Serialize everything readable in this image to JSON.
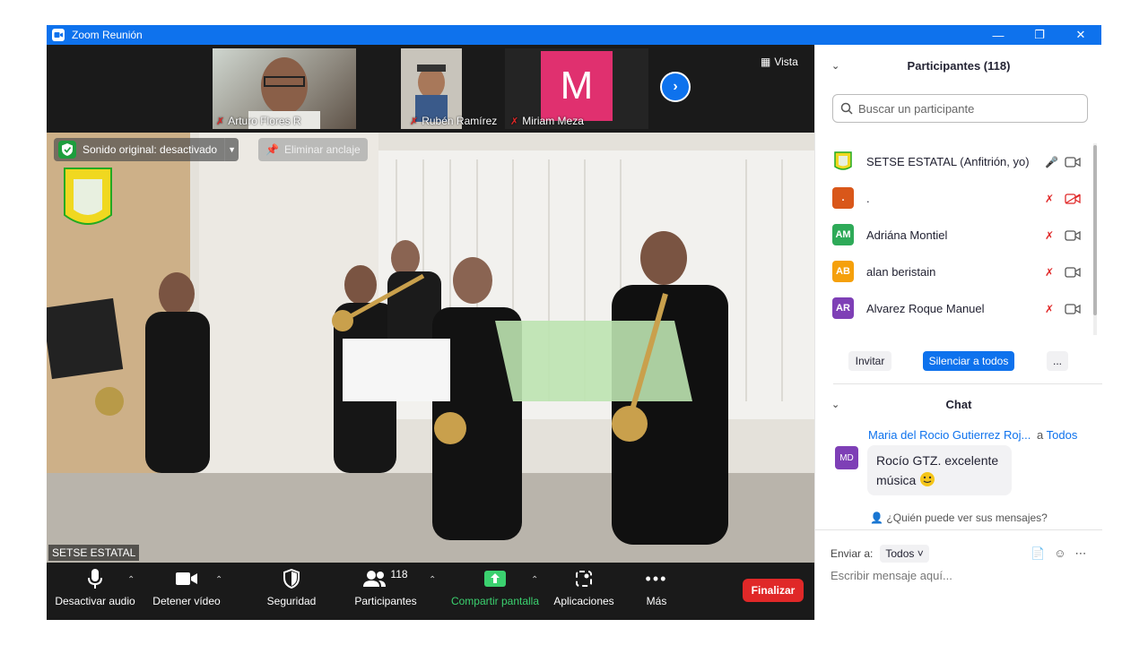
{
  "window": {
    "title": "Zoom Reunión"
  },
  "thumbnails": [
    {
      "name": "Arturo Flores R"
    },
    {
      "name": "Rubén Ramírez"
    },
    {
      "name": "Miriam Meza",
      "initial": "M"
    }
  ],
  "view_button": "Vista",
  "main_video": {
    "original_sound": "Sonido original: desactivado",
    "unpin_label": "Eliminar anclaje",
    "speaker_name": "SETSE ESTATAL"
  },
  "toolbar": {
    "mute": "Desactivar audio",
    "video": "Detener vídeo",
    "security": "Seguridad",
    "participants": "Participantes",
    "participants_count": "118",
    "share": "Compartir pantalla",
    "apps": "Aplicaciones",
    "more": "Más",
    "end": "Finalizar"
  },
  "participants_panel": {
    "title": "Participantes (118)",
    "search_placeholder": "Buscar un participante",
    "rows": [
      {
        "initials": "",
        "name": "SETSE ESTATAL (Anfitrión, yo)",
        "color": "#ffffff",
        "mic": "on",
        "cam": "on"
      },
      {
        "initials": ".",
        "name": ".",
        "color": "#d9571a",
        "mic": "off",
        "cam": "off"
      },
      {
        "initials": "AM",
        "name": "Adriána Montiel",
        "color": "#2eaa58",
        "mic": "off",
        "cam": "on"
      },
      {
        "initials": "AB",
        "name": "alan beristain",
        "color": "#f5a00b",
        "mic": "off",
        "cam": "on"
      },
      {
        "initials": "AR",
        "name": "Alvarez Roque Manuel",
        "color": "#7e3fb6",
        "mic": "off",
        "cam": "on"
      }
    ],
    "invite": "Invitar",
    "mute_all": "Silenciar a todos",
    "more": "..."
  },
  "chat": {
    "title": "Chat",
    "sender": "Maria del Rocio Gutierrez Roj...",
    "to_prefix": "a",
    "to": "Todos",
    "avatar": "MD",
    "message": "Rocío GTZ. excelente música",
    "who_sees": "¿Quién puede ver sus mensajes?",
    "send_to_label": "Enviar a:",
    "send_to_value": "Todos",
    "input_placeholder": "Escribir mensaje aquí..."
  }
}
